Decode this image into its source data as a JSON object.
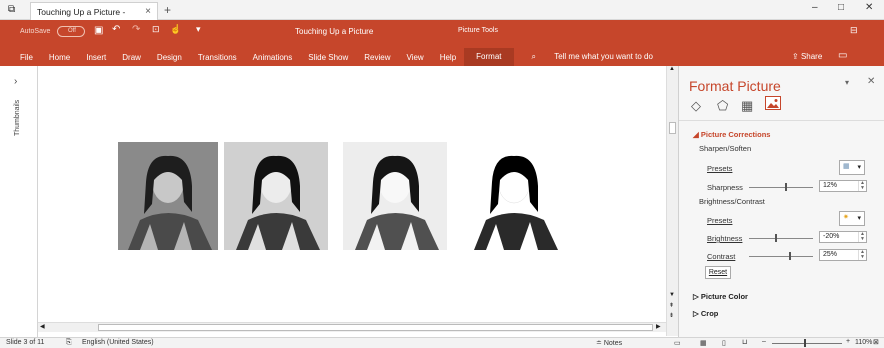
{
  "browser": {
    "tab_title": "Touching Up a Picture -",
    "close": "×",
    "new_tab": "+"
  },
  "window": {
    "title": "Touching Up a Picture",
    "contextual": "Picture Tools",
    "minimize": "–",
    "maximize": "□",
    "close": "✕"
  },
  "qat": {
    "autosave": "AutoSave",
    "autosave_state": "Off"
  },
  "ribbon": {
    "tabs": [
      "File",
      "Home",
      "Insert",
      "Draw",
      "Design",
      "Transitions",
      "Animations",
      "Slide Show",
      "Review",
      "View",
      "Help",
      "Format"
    ],
    "tell_me": "Tell me what you want to do",
    "share": "Share"
  },
  "thumbnails": {
    "label": "Thumbnails",
    "chevron": "›"
  },
  "panel": {
    "title": "Format Picture",
    "section_corrections": "Picture Corrections",
    "sharpen_soften": "Sharpen/Soften",
    "presets_1": "Presets",
    "sharpness_label": "Sharpness",
    "sharpness_value": "12%",
    "brightness_contrast": "Brightness/Contrast",
    "presets_2": "Presets",
    "brightness_label": "Brightness",
    "brightness_value": "-20%",
    "contrast_label": "Contrast",
    "contrast_value": "25%",
    "reset": "Reset",
    "section_color": "Picture Color",
    "section_crop": "Crop"
  },
  "status": {
    "slide": "Slide 3 of 11",
    "language": "English (United States)",
    "notes": "Notes",
    "zoom": "110%"
  }
}
